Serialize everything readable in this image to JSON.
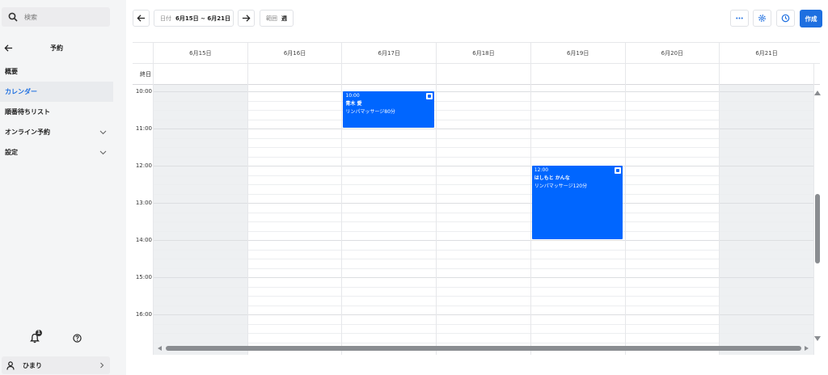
{
  "sidebar": {
    "search_placeholder": "検索",
    "title": "予約",
    "items": [
      {
        "label": "概要",
        "active": false,
        "expandable": false
      },
      {
        "label": "カレンダー",
        "active": true,
        "expandable": false
      },
      {
        "label": "順番待ちリスト",
        "active": false,
        "expandable": false
      },
      {
        "label": "オンライン予約",
        "active": false,
        "expandable": true
      },
      {
        "label": "設定",
        "active": false,
        "expandable": true
      }
    ],
    "notification_count": "1",
    "user_name": "ひまり"
  },
  "toolbar": {
    "date_label": "日付",
    "date_value": "6月15日 ~ 6月21日",
    "scope_label": "範囲",
    "scope_value": "週",
    "create_label": "作成"
  },
  "calendar": {
    "days": [
      "6月15日",
      "6月16日",
      "6月17日",
      "6月18日",
      "6月19日",
      "6月20日",
      "6月21日"
    ],
    "weekend_columns": [
      0,
      6
    ],
    "allday_label": "終日",
    "hours": [
      "10:00",
      "11:00",
      "12:00",
      "13:00",
      "14:00",
      "15:00",
      "16:00"
    ],
    "events": [
      {
        "day": 2,
        "start": "10:00",
        "time": "10:00",
        "name": "青木 愛",
        "service": "リンパマッサージ80分"
      },
      {
        "day": 4,
        "start": "12:00",
        "time": "12:00",
        "name": "はしもと かんな",
        "service": "リンパマッサージ120分"
      }
    ]
  },
  "colors": {
    "accent": "#1e6fe0",
    "event": "#0066ff",
    "weekend": "#eef0f2"
  }
}
